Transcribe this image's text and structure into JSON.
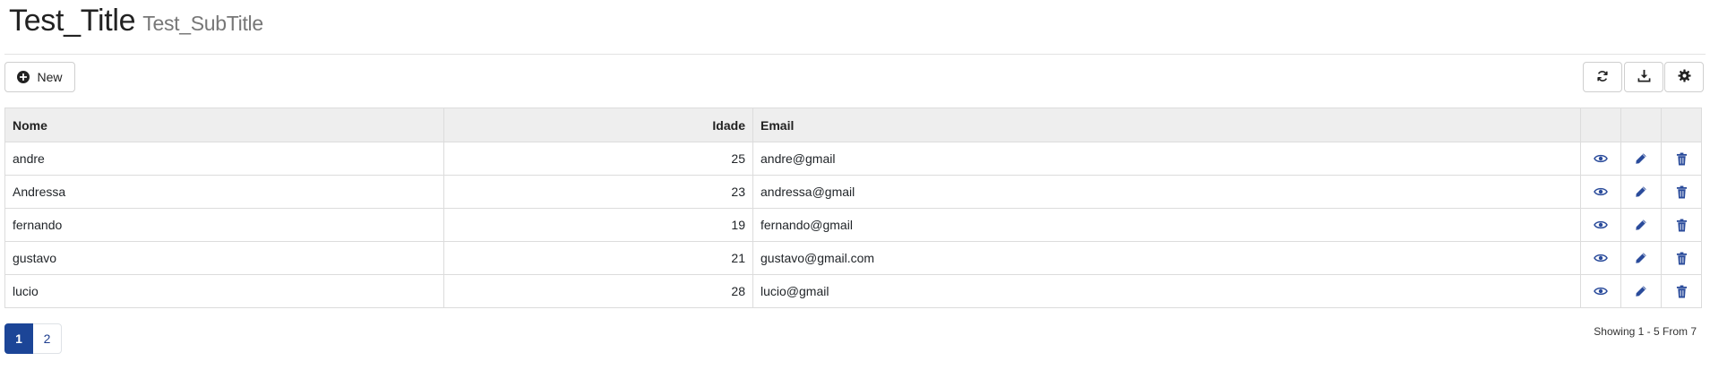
{
  "header": {
    "title": "Test_Title",
    "subtitle": "Test_SubTitle"
  },
  "toolbar": {
    "new_label": "New",
    "icons": [
      "plus-circle-icon",
      "refresh-icon",
      "download-icon",
      "gear-icon"
    ]
  },
  "table": {
    "columns": [
      "Nome",
      "Idade",
      "Email"
    ],
    "rows": [
      {
        "nome": "andre",
        "idade": "25",
        "email": "andre@gmail"
      },
      {
        "nome": "Andressa",
        "idade": "23",
        "email": "andressa@gmail"
      },
      {
        "nome": "fernando",
        "idade": "19",
        "email": "fernando@gmail"
      },
      {
        "nome": "gustavo",
        "idade": "21",
        "email": "gustavo@gmail.com"
      },
      {
        "nome": "lucio",
        "idade": "28",
        "email": "lucio@gmail"
      }
    ],
    "row_actions": [
      "eye-icon",
      "pencil-icon",
      "trash-icon"
    ]
  },
  "pagination": {
    "pages": [
      "1",
      "2"
    ],
    "current": "1",
    "showing_text": "Showing 1 - 5 From  7"
  },
  "colors": {
    "accent": "#1c4597",
    "header_bg": "#eeeeee"
  }
}
